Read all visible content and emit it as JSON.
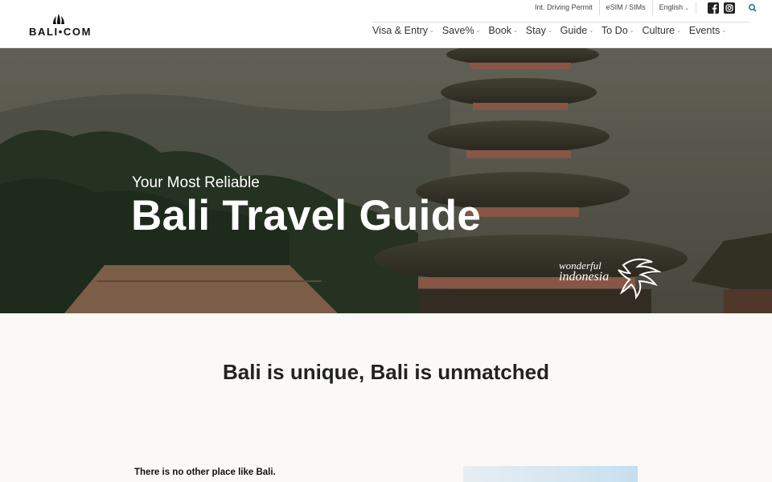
{
  "brand": {
    "logo_text": "BALI•COM"
  },
  "utility": {
    "links": [
      "Int. Driving Permit",
      "eSIM / SIMs"
    ],
    "language": "English",
    "social": [
      "facebook-icon",
      "instagram-icon"
    ]
  },
  "nav": {
    "items": [
      {
        "label": "Visa & Entry"
      },
      {
        "label": "Save%"
      },
      {
        "label": "Book"
      },
      {
        "label": "Stay"
      },
      {
        "label": "Guide"
      },
      {
        "label": "To Do"
      },
      {
        "label": "Culture"
      },
      {
        "label": "Events"
      }
    ],
    "caret": "⌄"
  },
  "hero": {
    "subtitle": "Your Most Reliable",
    "title": "Bali Travel Guide",
    "badge_line1": "wonderful",
    "badge_line2": "indonesia"
  },
  "content": {
    "tagline": "Bali is unique, Bali is unmatched",
    "intro": "There is no other place like Bali."
  },
  "colors": {
    "accent": "#1a6a8a",
    "hero_bg": "#5b5c50",
    "page_bg": "#faf9f5"
  }
}
